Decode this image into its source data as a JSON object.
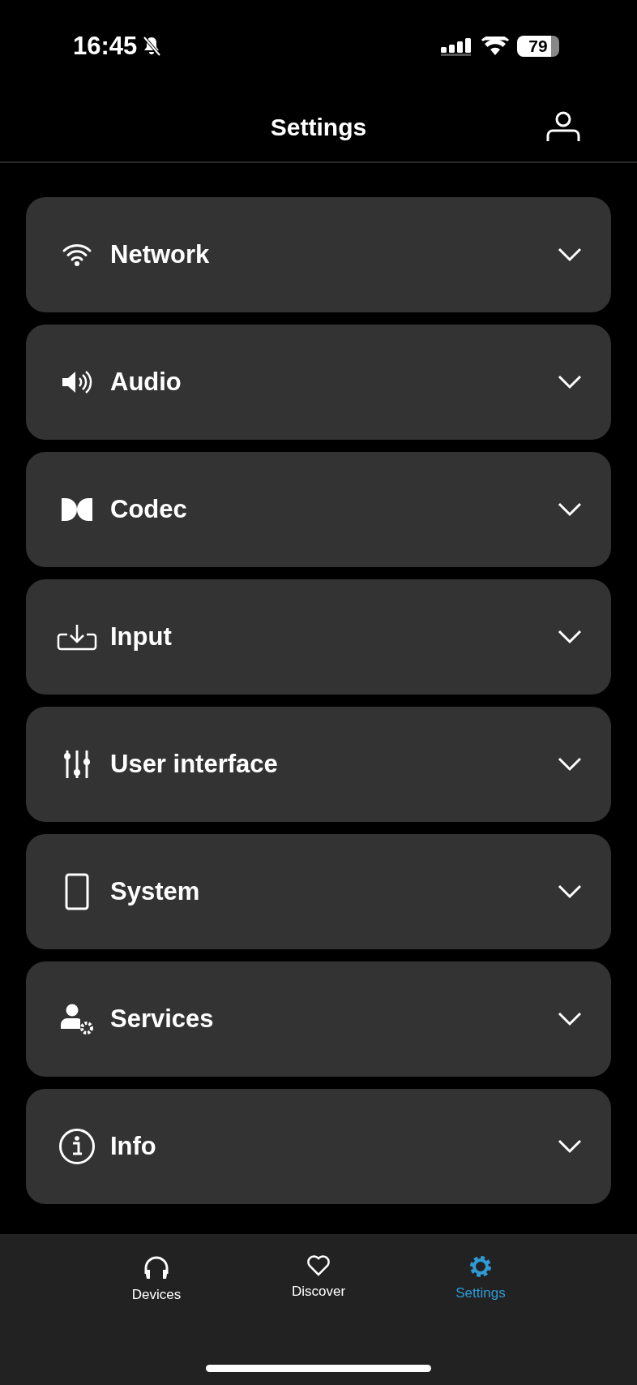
{
  "status_bar": {
    "time": "16:45",
    "silent": true,
    "battery": "79"
  },
  "header": {
    "title": "Settings"
  },
  "sections": [
    {
      "label": "Network",
      "expanded": false
    },
    {
      "label": "Audio",
      "expanded": false
    },
    {
      "label": "Codec",
      "expanded": false
    },
    {
      "label": "Input",
      "expanded": false
    },
    {
      "label": "User interface",
      "expanded": false
    },
    {
      "label": "System",
      "expanded": false
    },
    {
      "label": "Services",
      "expanded": false
    },
    {
      "label": "Info",
      "expanded": false
    }
  ],
  "tabs": [
    {
      "label": "Devices",
      "selected": false
    },
    {
      "label": "Discover",
      "selected": false
    },
    {
      "label": "Settings",
      "selected": true
    }
  ]
}
